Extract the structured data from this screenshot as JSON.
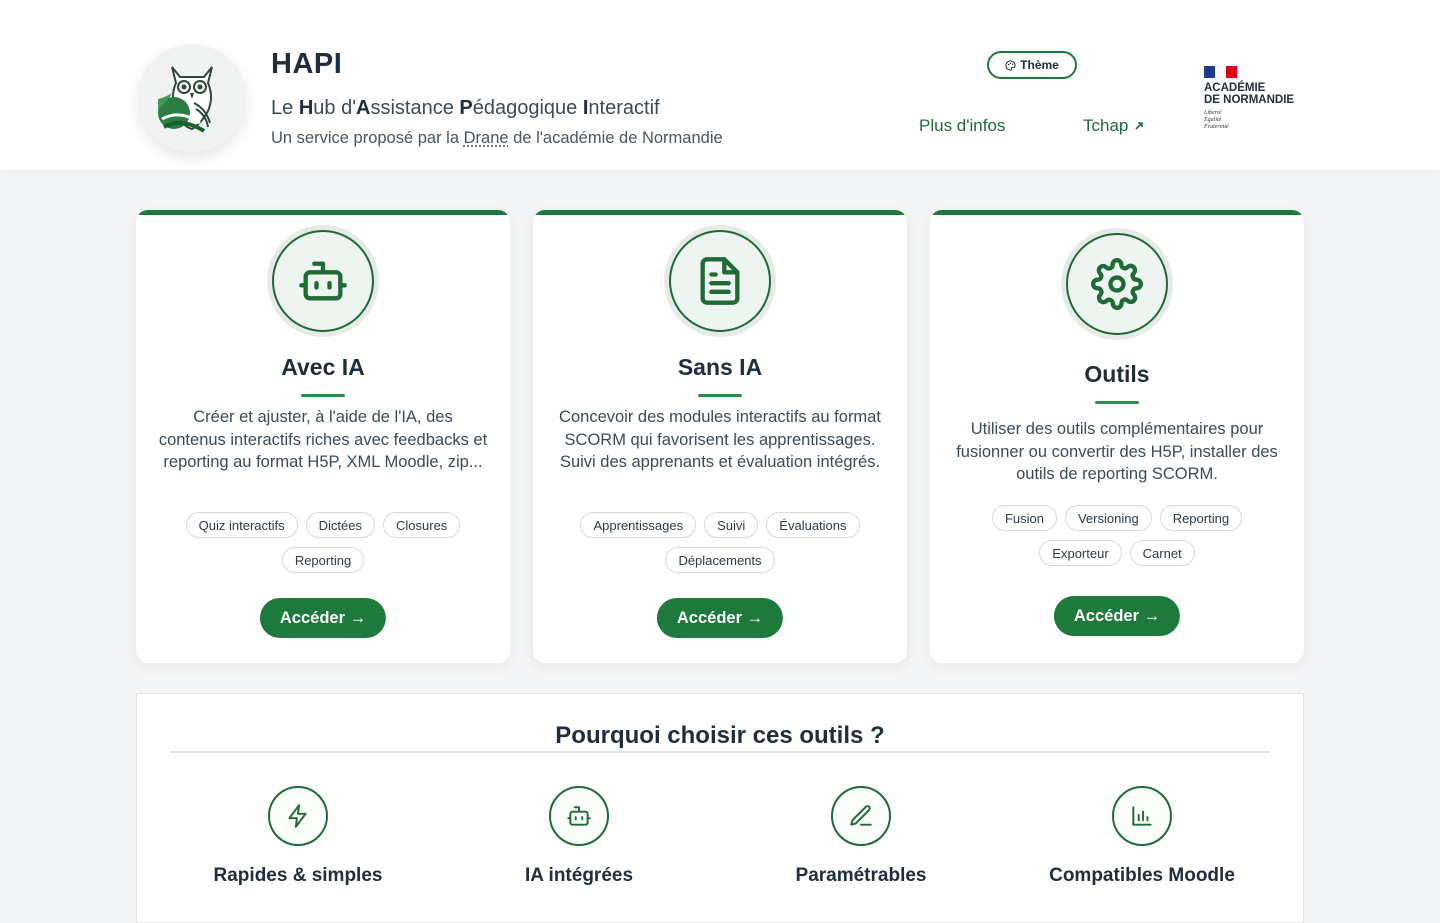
{
  "header": {
    "app_title": "HAPI",
    "subtitle": {
      "p1": "Le ",
      "b1": "H",
      "p2": "ub d'",
      "b2": "A",
      "p3": "ssistance ",
      "b3": "P",
      "p4": "édagogique ",
      "b4": "I",
      "p5": "nteractif"
    },
    "tagline": {
      "before": "Un service proposé par la ",
      "drane": "Drane",
      "after": " de l'académie de Normandie"
    },
    "theme_button": "Thème",
    "nav": {
      "more_info": "Plus d'infos",
      "tchap": "Tchap"
    },
    "academie": {
      "line1": "ACADÉMIE",
      "line2": "DE NORMANDIE",
      "motto1": "Liberté",
      "motto2": "Égalité",
      "motto3": "Fraternité"
    }
  },
  "cards": [
    {
      "icon": "robot-icon",
      "title": "Avec IA",
      "description": "Créer et ajuster, à l'aide de l'IA, des contenus interactifs riches avec feedbacks et reporting au format H5P, XML Moodle, zip...",
      "tags": [
        "Quiz interactifs",
        "Dictées",
        "Closures",
        "Reporting"
      ],
      "button": "Accéder →"
    },
    {
      "icon": "document-icon",
      "title": "Sans IA",
      "description": "Concevoir des modules interactifs au format SCORM qui favorisent les apprentissages. Suivi des apprenants et évaluation intégrés.",
      "tags": [
        "Apprentissages",
        "Suivi",
        "Évaluations",
        "Déplacements"
      ],
      "button": "Accéder →"
    },
    {
      "icon": "gear-icon",
      "title": "Outils",
      "description": "Utiliser des outils complémentaires pour fusionner ou convertir des H5P, installer des outils de reporting SCORM.",
      "tags": [
        "Fusion",
        "Versioning",
        "Reporting",
        "Exporteur",
        "Carnet"
      ],
      "button": "Accéder →"
    }
  ],
  "why": {
    "title": "Pourquoi choisir ces outils ?",
    "features": [
      {
        "icon": "lightning-icon",
        "label": "Rapides & simples"
      },
      {
        "icon": "robot-icon",
        "label": "IA intégrées"
      },
      {
        "icon": "pencil-icon",
        "label": "Paramétrables"
      },
      {
        "icon": "bar-chart-icon",
        "label": "Compatibles Moodle"
      }
    ]
  },
  "colors": {
    "primary": "#1e7a3c",
    "primary_dark": "#1e6b35",
    "text": "#1f2d3d",
    "background": "#f4f5f6"
  }
}
